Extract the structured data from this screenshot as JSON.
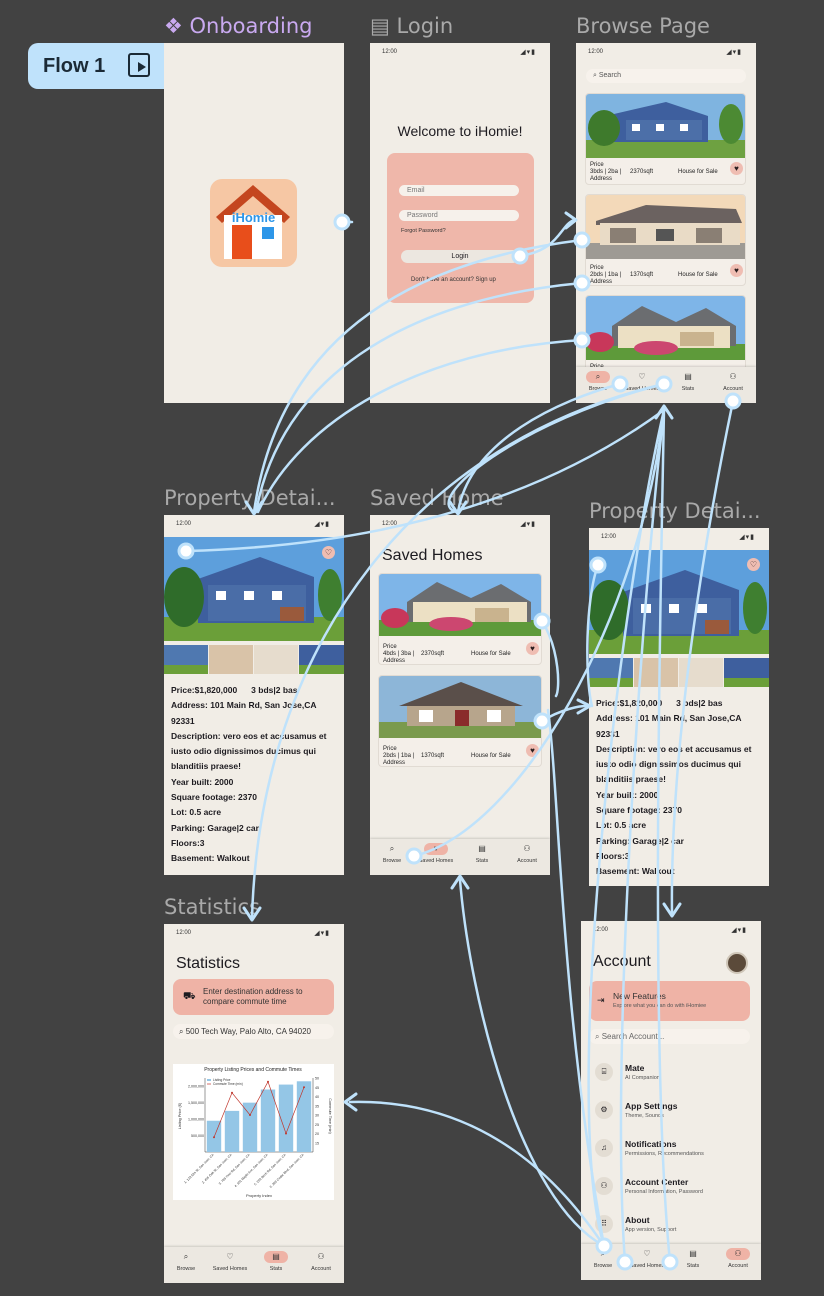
{
  "flow_badge": {
    "label": "Flow 1",
    "icon": "play-frame-icon"
  },
  "frame_labels": {
    "onboarding": "Onboarding",
    "login": "Login",
    "browse": "Browse Page",
    "detail1": "Property Detai...",
    "saved": "Saved Home",
    "detail2": "Property Detai...",
    "statistics": "Statistics"
  },
  "status_bar": {
    "time": "12:00"
  },
  "onboarding": {
    "logo_text": "iHomie"
  },
  "login": {
    "title": "Welcome to iHomie!",
    "email_placeholder": "Email",
    "password_placeholder": "Password",
    "forgot": "Forgot Password?",
    "button": "Login",
    "signup": "Don't have an account? Sign up"
  },
  "browse": {
    "search_placeholder": "Search",
    "cards": [
      {
        "line1": "Price",
        "line2": "3bds | 2ba |",
        "sqft": "2370sqft",
        "status": "House for Sale",
        "line3": "Address"
      },
      {
        "line1": "Price",
        "line2": "2bds | 1ba |",
        "sqft": "1370sqft",
        "status": "House for Sale",
        "line3": "Address"
      },
      {
        "line1": "Price"
      }
    ]
  },
  "nav": {
    "browse": "Browse",
    "saved": "Saved Homes",
    "stats": "Stats",
    "account": "Account"
  },
  "detail": {
    "price": "Price:$1,820,000",
    "beds": "3 bds|2 bas",
    "address": "Address: 101 Main Rd, San Jose,CA 92331",
    "description": "Description: vero eos et accusamus et iusto odio dignissimos ducimus qui blanditiis praese!",
    "year": "Year built: 2000",
    "sqft": "Square footage: 2370",
    "lot": "Lot: 0.5 acre",
    "parking": "Parking: Garage|2 car",
    "floors": "Floors:3",
    "basement": "Basement: Walkout"
  },
  "saved": {
    "title": "Saved Homes",
    "cards": [
      {
        "line1": "Price",
        "line2": "4bds | 3ba |",
        "sqft": "2370sqft",
        "status": "House for Sale",
        "line3": "Address"
      },
      {
        "line1": "Price",
        "line2": "2bds | 1ba |",
        "sqft": "1370sqft",
        "status": "House for Sale",
        "line3": "Address"
      }
    ]
  },
  "statistics": {
    "title": "Statistics",
    "banner": "Enter destination address to compare commute time",
    "address_value": "500 Tech Way, Palo Alto, CA 94020"
  },
  "account": {
    "title": "Account",
    "banner_title": "New Features",
    "banner_sub": "Explore what you can do with iHomiee",
    "search_placeholder": "Search Account...",
    "items": [
      {
        "title": "Mate",
        "sub": "AI Companion",
        "icon": "chat-icon"
      },
      {
        "title": "App Settings",
        "sub": "Theme, Sounds",
        "icon": "gear-icon"
      },
      {
        "title": "Notifications",
        "sub": "Permissions, Recommendations",
        "icon": "bell-icon"
      },
      {
        "title": "Account Center",
        "sub": "Personal Information, Password",
        "icon": "person-icon"
      },
      {
        "title": "About",
        "sub": "App version, Support",
        "icon": "dots-icon"
      }
    ]
  },
  "chart_data": {
    "type": "bar",
    "title": "Property Listing Prices and Commute Times",
    "xlabel": "Property Index",
    "ylabel": "Listing Price ($)",
    "y2label": "Commute Time (min)",
    "legend": [
      "Listing Price",
      "Commute Time (min)"
    ],
    "categories": [
      "1. 123 Elm St, San Jose, CA",
      "2. 456 Oak St, San Jose, CA",
      "3. 789 Pine Rd, San Jose, CA",
      "4. 101 Maple Ave, San Jose, CA",
      "5. 202 Birch Rd, San Jose, CA",
      "6. 303 Cedar Blvd, San Jose, CA"
    ],
    "series": [
      {
        "name": "Listing Price",
        "type": "bar",
        "values": [
          950000,
          1250000,
          1500000,
          1900000,
          2050000,
          2150000
        ]
      },
      {
        "name": "Commute Time (min)",
        "type": "line",
        "values": [
          18,
          42,
          30,
          48,
          20,
          45
        ]
      }
    ],
    "ylim": [
      0,
      2250000
    ],
    "y2lim": [
      10,
      50
    ],
    "yticks": [
      "500,000",
      "1,000,000",
      "1,500,000",
      "2,000,000"
    ],
    "y2ticks": [
      "15",
      "20",
      "25",
      "30",
      "35",
      "40",
      "45",
      "50"
    ]
  }
}
